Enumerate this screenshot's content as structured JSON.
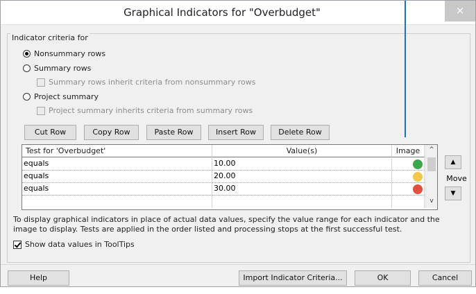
{
  "dialog": {
    "title": "Graphical Indicators for \"Overbudget\"",
    "close_glyph": "×"
  },
  "criteria": {
    "group_label": "Indicator criteria for",
    "nonsummary": "Nonsummary rows",
    "summary": "Summary rows",
    "summary_inherit": "Summary rows inherit criteria from nonsummary rows",
    "project_summary": "Project summary",
    "project_inherit": "Project summary inherits criteria from summary rows",
    "selected": "Nonsummary rows"
  },
  "toolbar": {
    "cut": "Cut Row",
    "copy": "Copy Row",
    "paste": "Paste Row",
    "insert": "Insert Row",
    "delete": "Delete Row"
  },
  "grid": {
    "headers": {
      "test": "Test for 'Overbudget'",
      "values": "Value(s)",
      "image": "Image"
    },
    "rows": [
      {
        "test": "equals",
        "value": "10.00",
        "image": "green-smiley-icon",
        "color": "#3aa84a"
      },
      {
        "test": "equals",
        "value": "20.00",
        "image": "yellow-neutral-icon",
        "color": "#f2c84b"
      },
      {
        "test": "equals",
        "value": "30.00",
        "image": "red-frown-icon",
        "color": "#e2503c"
      }
    ]
  },
  "move": {
    "up": "▲",
    "label": "Move",
    "down": "▼"
  },
  "description": "To display graphical indicators in place of actual data values, specify the value range for each indicator and the image to display.  Tests are applied in the order listed and processing stops at the first successful test.",
  "tooltip_option": {
    "label": "Show data values in ToolTips",
    "checked": true
  },
  "footer": {
    "help": "Help",
    "import": "Import Indicator Criteria...",
    "ok": "OK",
    "cancel": "Cancel"
  }
}
